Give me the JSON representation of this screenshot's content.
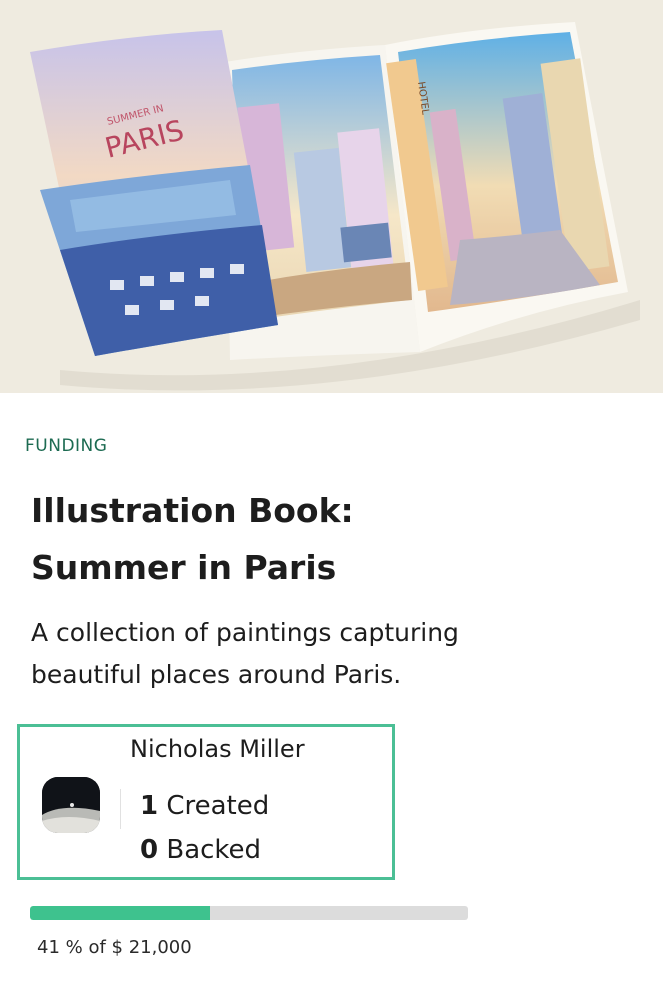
{
  "project": {
    "category": "FUNDING",
    "title_line1": "Illustration Book:",
    "title_line2": "Summer in Paris",
    "description_line1": "A collection of paintings capturing",
    "description_line2": "beautiful places around Paris.",
    "cover_text_small": "SUMMER IN",
    "cover_text_large": "PARIS",
    "hotel_sign": "HOTEL"
  },
  "creator": {
    "name": "Nicholas Miller",
    "avatar_icon": "avatar-photo",
    "created_count": "1",
    "created_label": "Created",
    "backed_count": "0",
    "backed_label": "Backed"
  },
  "funding": {
    "percent": 41,
    "progress_text": "41 % of $ 21,000"
  },
  "colors": {
    "accent": "#3ec28e",
    "card_border": "#4bbf95",
    "category": "#1d6b52",
    "hero_background": "#efebe0"
  }
}
